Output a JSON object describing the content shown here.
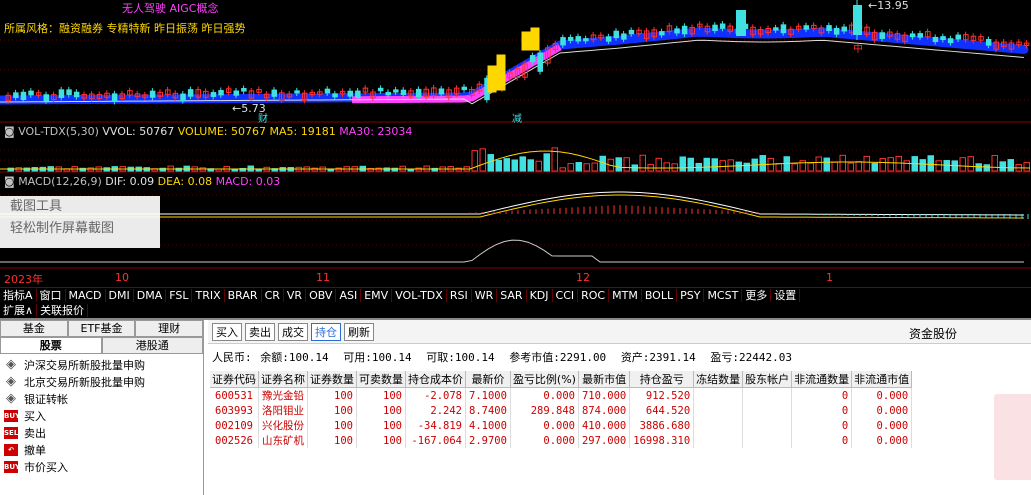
{
  "header": {
    "concept": "无人驾驶  AIGC概念",
    "style_label": "所属风格：融资融券 专精特新 昨日振荡 昨日强势",
    "high_marker": "13.95",
    "low_marker": "5.73",
    "cai_tag": "财",
    "jian_tag": "减",
    "zhong_tag": "中"
  },
  "vol_indicator": {
    "name": "VOL-TDX(5,30)",
    "vvol": "VVOL: 50767",
    "volume": "VOLUME: 50767",
    "ma5": "MA5: 19181",
    "ma30": "MA30: 23034"
  },
  "macd_indicator": {
    "name": "MACD(12,26,9)",
    "dif": "DIF: 0.09",
    "dea": "DEA: 0.08",
    "macd": "MACD: 0.03"
  },
  "watermark": {
    "line1": "截图工具",
    "line2": "轻松制作屏幕截图"
  },
  "timeline": {
    "labels": [
      "2023年",
      "10",
      "11",
      "12",
      "1"
    ]
  },
  "indicator_tabs": [
    "指标A",
    "窗口",
    "MACD",
    "DMI",
    "DMA",
    "FSL",
    "TRIX",
    "BRAR",
    "CR",
    "VR",
    "OBV",
    "ASI",
    "EMV",
    "VOL-TDX",
    "RSI",
    "WR",
    "SAR",
    "KDJ",
    "CCI",
    "ROC",
    "MTM",
    "BOLL",
    "PSY",
    "MCST",
    "更多",
    "设置"
  ],
  "ext_tabs": [
    "扩展∧",
    "关联报价"
  ],
  "left_tabs": {
    "row1": [
      "基金",
      "ETF基金",
      "理财"
    ],
    "row2": [
      "股票",
      "港股通"
    ]
  },
  "functions": [
    {
      "label": "沪深交易所新股批量申购",
      "icon": "gem-icon"
    },
    {
      "label": "北京交易所新股批量申购",
      "icon": "gem-icon"
    },
    {
      "label": "银证转帐",
      "icon": "gem-icon"
    },
    {
      "label": "买入",
      "icon": "buy-icon"
    },
    {
      "label": "卖出",
      "icon": "sell-icon"
    },
    {
      "label": "撤单",
      "icon": "cancel-icon"
    },
    {
      "label": "市价买入",
      "icon": "buy-icon"
    }
  ],
  "toolbar": {
    "buttons": [
      "买入",
      "卖出",
      "成交",
      "持仓",
      "刷新"
    ],
    "active": "持仓",
    "broker": "资金股份"
  },
  "balance": {
    "currency": "人民币:",
    "balance": "余额:100.14",
    "available": "可用:100.14",
    "withdrawable": "可取:100.14",
    "ref_market": "参考市值:2291.00",
    "assets": "资产:2391.14",
    "pnl": "盈亏:22442.03"
  },
  "holdings": {
    "columns": [
      "证券代码",
      "证券名称",
      "证券数量",
      "可卖数量",
      "持仓成本价",
      "最新价",
      "盈亏比例(%)",
      "最新市值",
      "持仓盈亏",
      "冻结数量",
      "股东帐户",
      "非流通数量",
      "非流通市值"
    ],
    "rows": [
      [
        "600531",
        "豫光金铅",
        "100",
        "100",
        "-2.078",
        "7.1000",
        "0.000",
        "710.000",
        "912.520",
        "",
        "",
        "0",
        "0.000"
      ],
      [
        "603993",
        "洛阳钼业",
        "100",
        "100",
        "2.242",
        "8.7400",
        "289.848",
        "874.000",
        "644.520",
        "",
        "",
        "0",
        "0.000"
      ],
      [
        "002109",
        "兴化股份",
        "100",
        "100",
        "-34.819",
        "4.1000",
        "0.000",
        "410.000",
        "3886.680",
        "",
        "",
        "0",
        "0.000"
      ],
      [
        "002526",
        "山东矿机",
        "100",
        "100",
        "-167.064",
        "2.9700",
        "0.000",
        "297.000",
        "16998.310",
        "",
        "",
        "0",
        "0.000"
      ]
    ]
  },
  "colors": {
    "up": "#ff3030",
    "down": "#40e0e0",
    "ma_line": "#1030ff",
    "ma_pink": "#ff40ff",
    "text_red": "#cc0000"
  }
}
